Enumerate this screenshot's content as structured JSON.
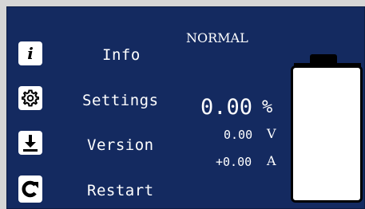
{
  "menu": {
    "items": [
      {
        "label": "Info",
        "icon": "info-icon"
      },
      {
        "label": "Settings",
        "icon": "gear-icon"
      },
      {
        "label": "Version",
        "icon": "download-icon"
      },
      {
        "label": "Restart",
        "icon": "restart-icon"
      }
    ]
  },
  "status": {
    "mode": "NORMAL",
    "percent": {
      "value": "0.00",
      "unit": "%"
    },
    "voltage": {
      "value": "0.00",
      "unit": "V"
    },
    "current": {
      "value": "+0.00",
      "unit": "A"
    }
  },
  "battery": {
    "level": 0
  },
  "colors": {
    "background": "#142a60",
    "text": "#ffffff",
    "button": "#ffffff",
    "battery_outline": "#000000"
  }
}
